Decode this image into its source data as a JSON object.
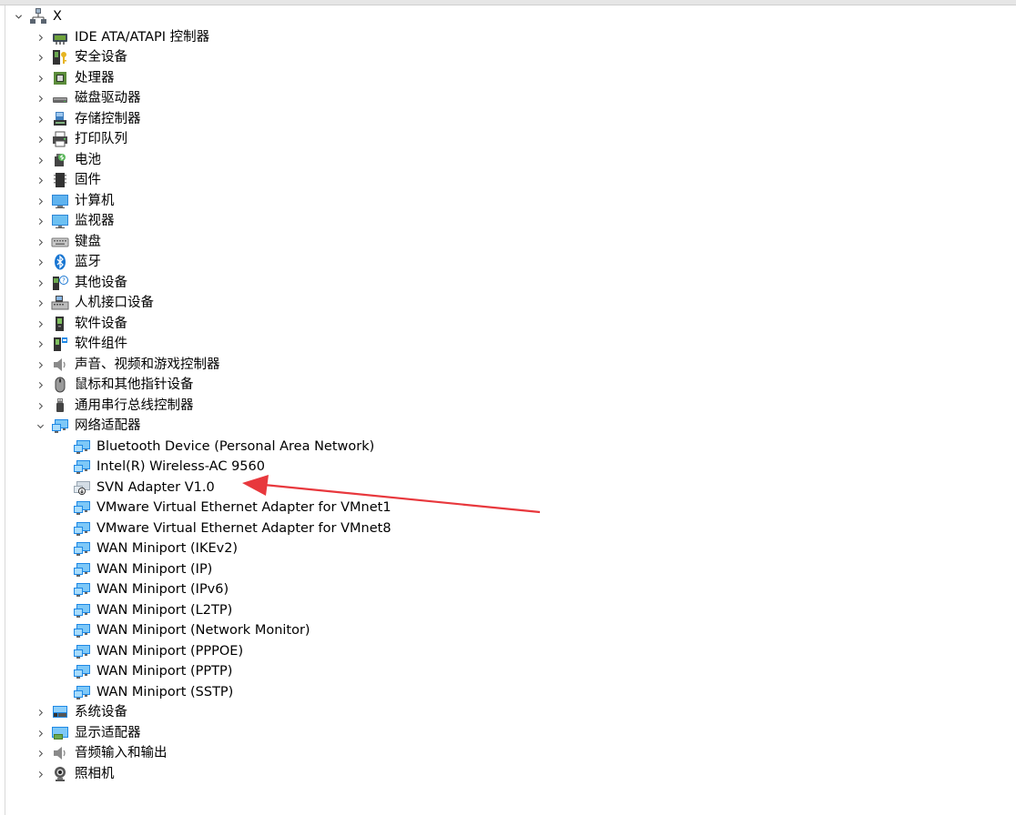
{
  "tree": {
    "root": {
      "label": "X",
      "icon": "computer-network-icon"
    },
    "categories": [
      {
        "label": "IDE ATA/ATAPI 控制器",
        "icon": "ide-controller-icon"
      },
      {
        "label": "安全设备",
        "icon": "security-device-icon"
      },
      {
        "label": "处理器",
        "icon": "processor-icon"
      },
      {
        "label": "磁盘驱动器",
        "icon": "disk-drive-icon"
      },
      {
        "label": "存储控制器",
        "icon": "storage-controller-icon"
      },
      {
        "label": "打印队列",
        "icon": "printer-icon"
      },
      {
        "label": "电池",
        "icon": "battery-icon"
      },
      {
        "label": "固件",
        "icon": "firmware-icon"
      },
      {
        "label": "计算机",
        "icon": "computer-icon"
      },
      {
        "label": "监视器",
        "icon": "monitor-icon"
      },
      {
        "label": "键盘",
        "icon": "keyboard-icon"
      },
      {
        "label": "蓝牙",
        "icon": "bluetooth-icon"
      },
      {
        "label": "其他设备",
        "icon": "other-device-icon"
      },
      {
        "label": "人机接口设备",
        "icon": "hid-icon"
      },
      {
        "label": "软件设备",
        "icon": "software-device-icon"
      },
      {
        "label": "软件组件",
        "icon": "software-component-icon"
      },
      {
        "label": "声音、视频和游戏控制器",
        "icon": "speaker-icon"
      },
      {
        "label": "鼠标和其他指针设备",
        "icon": "mouse-icon"
      },
      {
        "label": "通用串行总线控制器",
        "icon": "usb-icon"
      },
      {
        "label": "网络适配器",
        "icon": "network-adapter-icon",
        "expanded": true
      }
    ],
    "network_adapters": [
      {
        "label": "Bluetooth Device (Personal Area Network)",
        "icon": "network-adapter-icon"
      },
      {
        "label": "Intel(R) Wireless-AC 9560",
        "icon": "network-adapter-icon"
      },
      {
        "label": "SVN Adapter V1.0",
        "icon": "disabled-network-adapter-icon"
      },
      {
        "label": "VMware Virtual Ethernet Adapter for VMnet1",
        "icon": "network-adapter-icon"
      },
      {
        "label": "VMware Virtual Ethernet Adapter for VMnet8",
        "icon": "network-adapter-icon"
      },
      {
        "label": "WAN Miniport (IKEv2)",
        "icon": "network-adapter-icon"
      },
      {
        "label": "WAN Miniport (IP)",
        "icon": "network-adapter-icon"
      },
      {
        "label": "WAN Miniport (IPv6)",
        "icon": "network-adapter-icon"
      },
      {
        "label": "WAN Miniport (L2TP)",
        "icon": "network-adapter-icon"
      },
      {
        "label": "WAN Miniport (Network Monitor)",
        "icon": "network-adapter-icon"
      },
      {
        "label": "WAN Miniport (PPPOE)",
        "icon": "network-adapter-icon"
      },
      {
        "label": "WAN Miniport (PPTP)",
        "icon": "network-adapter-icon"
      },
      {
        "label": "WAN Miniport (SSTP)",
        "icon": "network-adapter-icon"
      }
    ],
    "after_categories": [
      {
        "label": "系统设备",
        "icon": "system-device-icon"
      },
      {
        "label": "显示适配器",
        "icon": "display-adapter-icon"
      },
      {
        "label": "音频输入和输出",
        "icon": "audio-io-icon"
      },
      {
        "label": "照相机",
        "icon": "camera-icon"
      }
    ]
  },
  "annotation": {
    "color": "#e8383d",
    "points_to": "SVN Adapter V1.0"
  }
}
